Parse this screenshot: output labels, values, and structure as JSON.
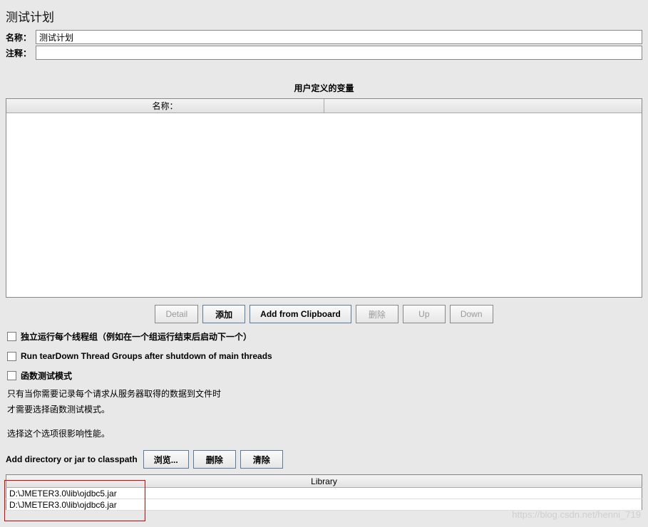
{
  "title": "测试计划",
  "labels": {
    "name": "名称：",
    "comment": "注释："
  },
  "values": {
    "name": "测试计划",
    "comment": ""
  },
  "section": {
    "user_vars_title": "用户定义的变量",
    "col_name": "名称："
  },
  "buttons": {
    "detail": "Detail",
    "add": "添加",
    "add_clipboard": "Add from Clipboard",
    "delete": "删除",
    "up": "Up",
    "down": "Down"
  },
  "checkboxes": {
    "independent_threads": "独立运行每个线程组（例如在一个组运行结束后启动下一个）",
    "teardown": "Run tearDown Thread Groups after shutdown of main threads",
    "functional_mode": "函数测试模式"
  },
  "hints": {
    "line1": "只有当你需要记录每个请求从服务器取得的数据到文件时",
    "line2": "才需要选择函数测试模式。",
    "line3": "选择这个选项很影响性能。"
  },
  "classpath": {
    "label": "Add directory or jar to classpath",
    "browse": "浏览...",
    "delete": "删除",
    "clear": "清除",
    "lib_header": "Library",
    "entries": [
      "D:\\JMETER3.0\\lib\\ojdbc5.jar",
      "D:\\JMETER3.0\\lib\\ojdbc6.jar"
    ]
  },
  "watermark": "https://blog.csdn.net/henni_719"
}
